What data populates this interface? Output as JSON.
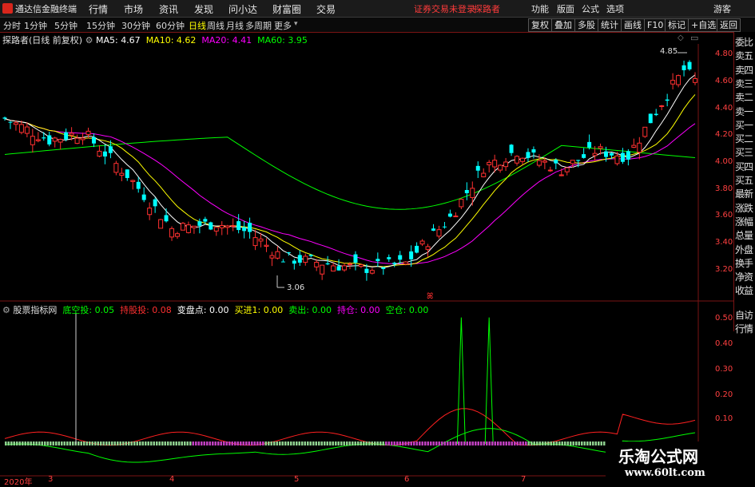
{
  "menubar": {
    "app_name": "通达信金融终端",
    "items": [
      "行情",
      "市场",
      "资讯",
      "发现",
      "问小达",
      "财富圈",
      "交易"
    ],
    "warning": "证券交易未登录",
    "user_label": "探路者",
    "right_items": [
      "功能",
      "版面",
      "公式",
      "选项"
    ],
    "guest": "游客"
  },
  "periodbar": {
    "periods": [
      "分时",
      "1分钟",
      "5分钟",
      "15分钟",
      "30分钟",
      "60分钟",
      "日线",
      "周线",
      "月线",
      "多周期",
      "更多"
    ],
    "selected": "日线",
    "tools": [
      "复权",
      "叠加",
      "多股",
      "统计",
      "画线",
      "F10",
      "标记",
      "+自选",
      "返回"
    ]
  },
  "main_chart": {
    "stock": "探路者(日线 前复权)",
    "ma": [
      {
        "label": "MA5:",
        "value": "4.67",
        "color": "#ffffff"
      },
      {
        "label": "MA10:",
        "value": "4.62",
        "color": "#ffff00"
      },
      {
        "label": "MA20:",
        "value": "4.41",
        "color": "#ff00ff"
      },
      {
        "label": "MA60:",
        "value": "3.95",
        "color": "#00ff00"
      }
    ],
    "y_ticks": [
      "4.80",
      "4.60",
      "4.40",
      "4.20",
      "4.00",
      "3.80",
      "3.60",
      "3.40",
      "3.20"
    ],
    "high_label": "4.85",
    "low_label": "3.06",
    "marker": "ꕤ"
  },
  "indicator": {
    "name": "股票指标网",
    "items": [
      {
        "label": "底空投:",
        "value": "0.05",
        "color": "#00ff00"
      },
      {
        "label": "持股投:",
        "value": "0.08",
        "color": "#ff3030"
      },
      {
        "label": "变盘点:",
        "value": "0.00",
        "color": "#ffffff"
      },
      {
        "label": "买进1:",
        "value": "0.00",
        "color": "#ffff00"
      },
      {
        "label": "卖出:",
        "value": "0.00",
        "color": "#00ff00"
      },
      {
        "label": "持仓:",
        "value": "0.00",
        "color": "#ff00ff"
      },
      {
        "label": "空仓:",
        "value": "0.00",
        "color": "#00ff00"
      }
    ],
    "y_ticks": [
      "0.50",
      "0.40",
      "0.30",
      "0.20",
      "0.10"
    ]
  },
  "side_panel": [
    "委比",
    "卖五",
    "卖四",
    "卖三",
    "卖二",
    "卖一",
    "买一",
    "买二",
    "买三",
    "买四",
    "买五",
    "最新",
    "涨跌",
    "涨幅",
    "总量",
    "外盘",
    "换手",
    "净资",
    "收益"
  ],
  "side_panel_bottom": [
    "自访",
    "行情"
  ],
  "x_axis": [
    "2020年",
    "3",
    "4",
    "5",
    "6",
    "7"
  ],
  "watermark": {
    "title": "乐淘公式网",
    "url": "www.60lt.com"
  },
  "colors": {
    "up": "#ff3030",
    "down": "#00ffff",
    "ma5": "#ffffff",
    "ma10": "#ffff00",
    "ma20": "#ff00ff",
    "ma60": "#00ff00",
    "axis": "#7a1414"
  }
}
